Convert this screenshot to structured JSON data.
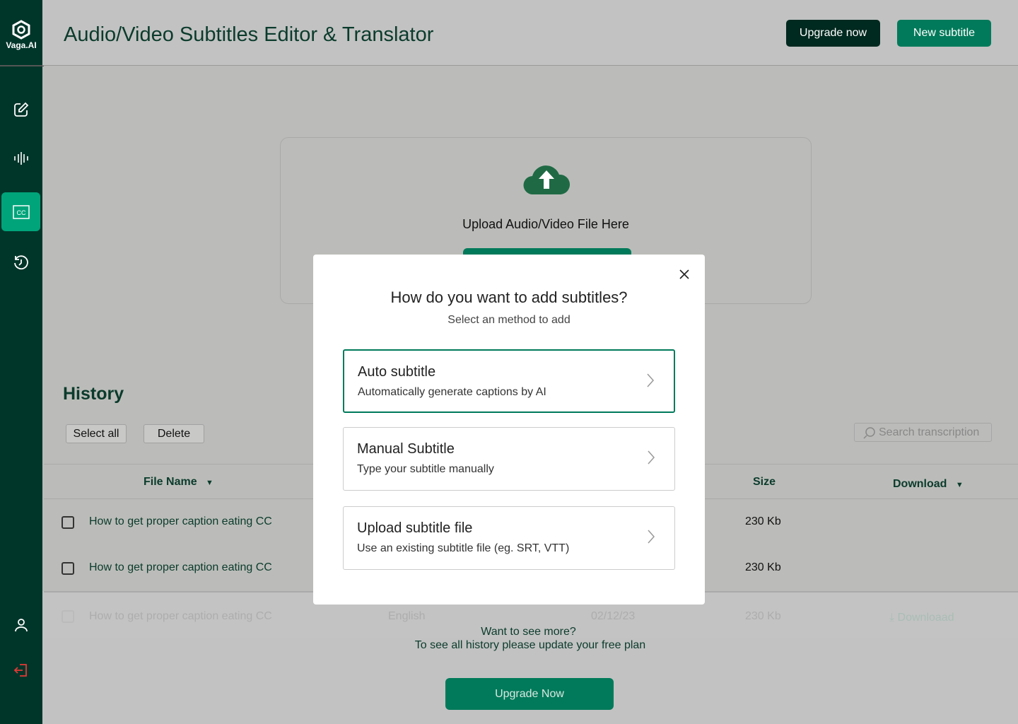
{
  "brand": {
    "name": "Vaga.AI"
  },
  "sidebar": {
    "items": [
      {
        "icon": "edit-icon"
      },
      {
        "icon": "waveform-icon"
      },
      {
        "icon": "closed-caption-icon",
        "active": true
      },
      {
        "icon": "history-icon"
      },
      {
        "icon": "user-icon"
      },
      {
        "icon": "logout-icon"
      }
    ]
  },
  "header": {
    "title": "Audio/Video Subtitles Editor & Translator",
    "upgrade_label": "Upgrade now",
    "new_label": "New subtitle"
  },
  "upload": {
    "label": "Upload Audio/Video File Here"
  },
  "history": {
    "title": "History",
    "select_all": "Select all",
    "delete": "Delete",
    "search_placeholder": "Search transcription",
    "columns": {
      "file_name": "File Name",
      "size": "Size",
      "download": "Download"
    },
    "rows": [
      {
        "name": "How to get proper caption eating CC",
        "size": "230 Kb"
      },
      {
        "name": "How to get proper caption eating CC",
        "size": "230 Kb"
      },
      {
        "name": "How to get proper caption eating CC",
        "language": "English",
        "date": "02/12/23",
        "size": "230 Kb",
        "download": "Downloaad"
      }
    ]
  },
  "more": {
    "line1": "Want to see more?",
    "line2": "To see all history please update your free plan",
    "button": "Upgrade Now"
  },
  "modal": {
    "title": "How do you want to add subtitles?",
    "subtitle": "Select an method to add",
    "options": [
      {
        "title": "Auto subtitle",
        "desc": "Automatically generate captions by AI",
        "selected": true
      },
      {
        "title": "Manual Subtitle",
        "desc": "Type your subtitle manually"
      },
      {
        "title": "Upload subtitle file",
        "desc": "Use an existing subtitle file (eg. SRT, VTT)"
      }
    ]
  },
  "colors": {
    "sidebar": "#00362a",
    "accent": "#007a5a",
    "active": "#00a47a",
    "dark_button": "#00291f"
  }
}
